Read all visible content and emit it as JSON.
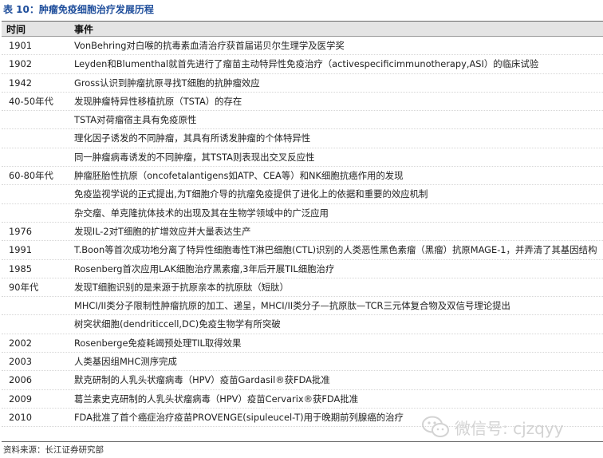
{
  "caption": "表 10：肿瘤免疫细胞治疗发展历程",
  "table": {
    "headers": [
      "时间",
      "事件"
    ],
    "rows": [
      {
        "time": "1901",
        "event": "VonBehring对白喉的抗毒素血清治疗获首届诺贝尔生理学及医学奖"
      },
      {
        "time": "1902",
        "event": "Leyden和Blumenthal就首先进行了瘤苗主动特异性免疫治疗（activespecificimmunotherapy,ASI）的临床试验"
      },
      {
        "time": "1942",
        "event": "Gross认识到肿瘤抗原寻找T细胞的抗肿瘤效应"
      },
      {
        "time": "40-50年代",
        "event": "发现肿瘤特异性移植抗原（TSTA）的存在"
      },
      {
        "time": "",
        "event": "TSTA对荷瘤宿主具有免疫原性"
      },
      {
        "time": "",
        "event": "理化因子诱发的不同肿瘤，其具有所诱发肿瘤的个体特异性"
      },
      {
        "time": "",
        "event": "同一肿瘤病毒诱发的不同肿瘤，其TSTA则表现出交叉反应性"
      },
      {
        "time": "60-80年代",
        "event": "肿瘤胚胎性抗原（oncofetalantigens如ATP、CEA等）和NK细胞抗癌作用的发现"
      },
      {
        "time": "",
        "event": "免疫监视学说的正式提出,为T细胞介导的抗瘤免疫提供了进化上的依据和重要的效应机制"
      },
      {
        "time": "",
        "event": "杂交瘤、单克隆抗体技术的出现及其在生物学领域中的广泛应用"
      },
      {
        "time": "1976",
        "event": "发现IL-2对T细胞的扩增效应并大量表达生产"
      },
      {
        "time": "1991",
        "event": "T.Boon等首次成功地分离了特异性细胞毒性T淋巴细胞(CTL)识别的人类恶性黑色素瘤（黑瘤）抗原MAGE-1，并弄清了其基因结构"
      },
      {
        "time": "1985",
        "event": "Rosenberg首次应用LAK细胞治疗黑素瘤,3年后开展TIL细胞治疗"
      },
      {
        "time": "90年代",
        "event": "发现T细胞识别的是来源于抗原亲本的抗原肽（短肽）"
      },
      {
        "time": "",
        "event": "MHCI/II类分子限制性肿瘤抗原的加工、递呈，MHCI/II类分子—抗原肽—TCR三元体复合物及双信号理论提出"
      },
      {
        "time": "",
        "event": "树突状细胞(dendriticcell,DC)免疫生物学有所突破"
      },
      {
        "time": "2002",
        "event": "Rosenberge免疫耗竭预处理TIL取得效果"
      },
      {
        "time": "2003",
        "event": "人类基因组MHC测序完成"
      },
      {
        "time": "2006",
        "event": "默克研制的人乳头状瘤病毒（HPV）疫苗Gardasil®获FDA批准"
      },
      {
        "time": "2009",
        "event": "葛兰素史克研制的人乳头状瘤病毒（HPV）疫苗Cervarix®获FDA批准"
      },
      {
        "time": "2010",
        "event": "FDA批准了首个癌症治疗疫苗PROVENGE(sipuleucel-T)用于晚期前列腺癌的治疗"
      }
    ]
  },
  "source": "资料来源：长江证券研究部",
  "watermark": {
    "text": "微信号: cjzqyy",
    "icon": "wechat-icon"
  }
}
